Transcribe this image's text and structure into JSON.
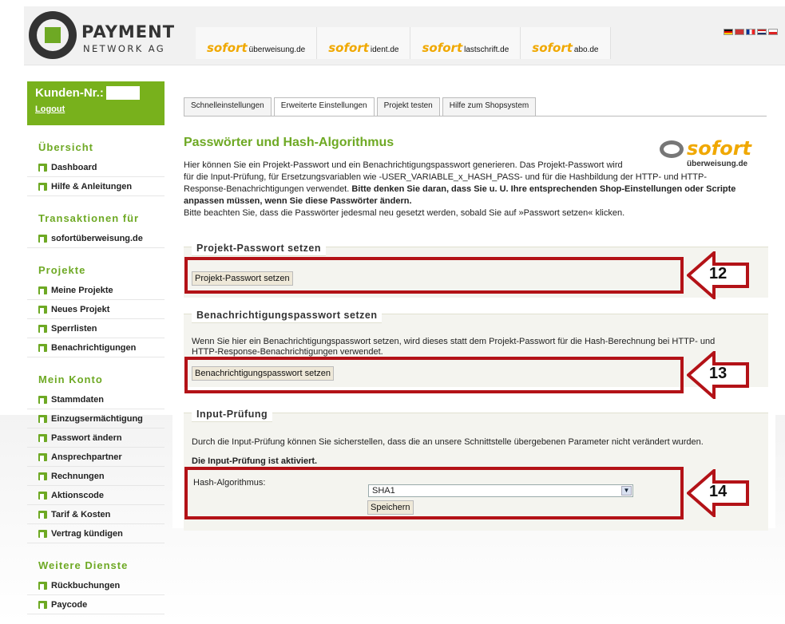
{
  "header": {
    "logo_main": "PAYMENT",
    "logo_sub": "NETWORK AG",
    "nav": [
      {
        "brand": "sofort",
        "domain": "überweisung.de"
      },
      {
        "brand": "sofort",
        "domain": "ident.de"
      },
      {
        "brand": "sofort",
        "domain": "lastschrift.de"
      },
      {
        "brand": "sofort",
        "domain": "abo.de"
      }
    ],
    "flags": [
      "de",
      "gb",
      "fr",
      "nl",
      "pl"
    ]
  },
  "sidebar": {
    "customer_label": "Kunden-Nr.:",
    "logout": "Logout",
    "sections": [
      {
        "title": "Übersicht",
        "items": [
          "Dashboard",
          "Hilfe & Anleitungen"
        ]
      },
      {
        "title": "Transaktionen für",
        "items": [
          "sofortüberweisung.de"
        ]
      },
      {
        "title": "Projekte",
        "items": [
          "Meine Projekte",
          "Neues Projekt",
          "Sperrlisten",
          "Benachrichtigungen"
        ]
      },
      {
        "title": "Mein Konto",
        "items": [
          "Stammdaten",
          "Einzugsermächtigung",
          "Passwort ändern",
          "Ansprechpartner",
          "Rechnungen",
          "Aktionscode",
          "Tarif & Kosten",
          "Vertrag kündigen"
        ]
      },
      {
        "title": "Weitere Dienste",
        "items": [
          "Rückbuchungen",
          "Paycode"
        ]
      }
    ]
  },
  "tabs": [
    "Schnelleinstellungen",
    "Erweiterte Einstellungen",
    "Projekt testen",
    "Hilfe zum Shopsystem"
  ],
  "page": {
    "title": "Passwörter und Hash-Algorithmus",
    "sofort_logo_word": "sofort",
    "sofort_logo_domain": "überweisung.de",
    "intro_1": "Hier können Sie ein Projekt-Passwort und ein Benachrichtigungspasswort generieren. Das Projekt-Passwort wird",
    "intro_2": "für die Input-Prüfung, für Ersetzungsvariablen wie -USER_VARIABLE_x_HASH_PASS- und für die Hashbildung der HTTP- und HTTP-",
    "intro_3a": "Response-Benachrichtigungen verwendet. ",
    "intro_3b": "Bitte denken Sie daran, dass Sie u. U. Ihre entsprechenden Shop-Einstellungen oder Scripte",
    "intro_4": "anpassen müssen, wenn Sie diese Passwörter ändern.",
    "intro_5": "Bitte beachten Sie, dass die Passwörter jedesmal neu gesetzt werden, sobald Sie auf »Passwort setzen« klicken."
  },
  "section_project": {
    "legend": "Projekt-Passwort setzen",
    "button": "Projekt-Passwort setzen"
  },
  "section_notify": {
    "legend": "Benachrichtigungspasswort setzen",
    "text_1": "Wenn Sie hier ein Benachrichtigungspasswort setzen, wird dieses statt dem Projekt-Passwort für die Hash-Berechnung bei HTTP- und",
    "text_2": "HTTP-Response-Benachrichtigungen verwendet.",
    "button": "Benachrichtigungspasswort setzen"
  },
  "section_input": {
    "legend": "Input-Prüfung",
    "text": "Durch die Input-Prüfung können Sie sicherstellen, dass die an unsere Schnittstelle übergebenen Parameter nicht verändert wurden.",
    "status": "Die Input-Prüfung ist aktiviert.",
    "hash_label": "Hash-Algorithmus:",
    "hash_value": "SHA1",
    "save": "Speichern"
  },
  "callouts": [
    "12",
    "13",
    "14"
  ],
  "colors": {
    "brand_green": "#78b11c",
    "sofort_orange": "#f0a800",
    "callout_red": "#b31217"
  }
}
